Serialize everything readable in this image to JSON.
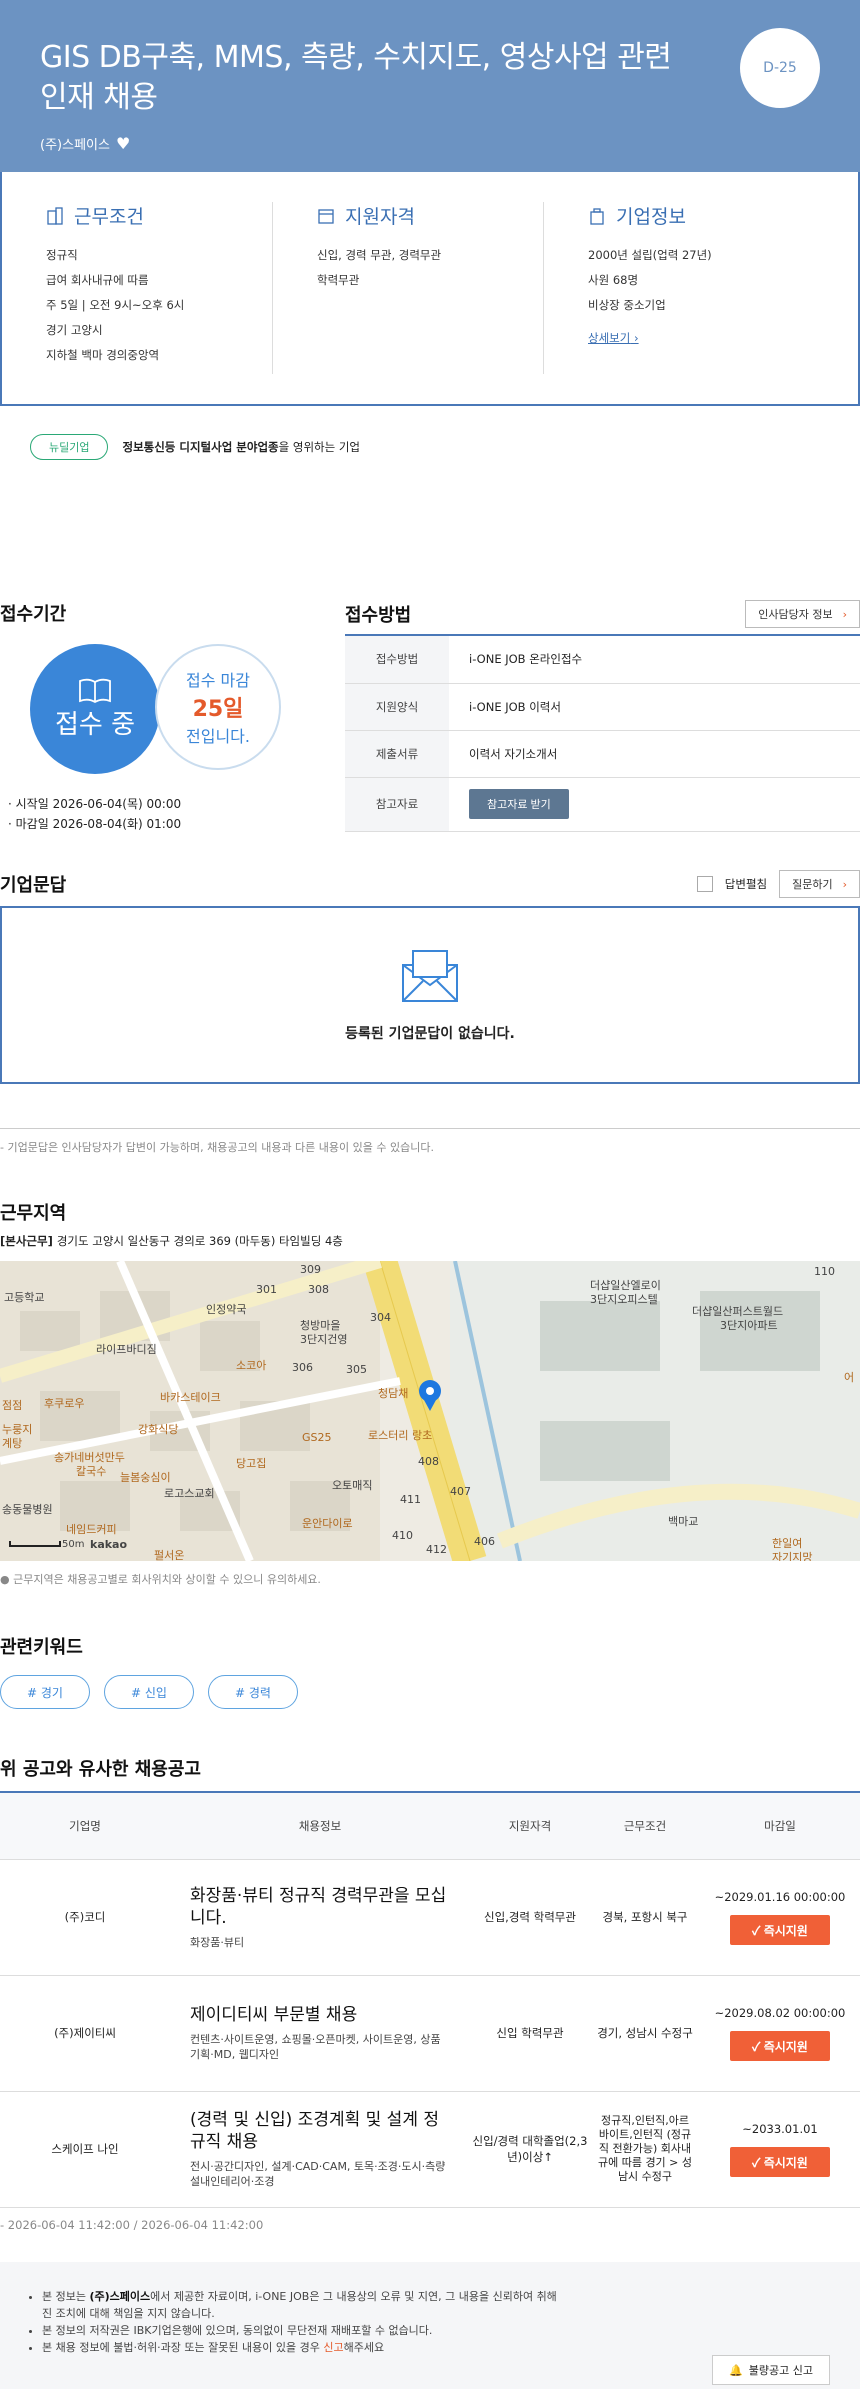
{
  "header": {
    "title": "GIS DB구축, MMS, 측량, 수치지도, 영상사업 관련 인재 채용",
    "company": "(주)스페이스",
    "dday": "D-25"
  },
  "info": {
    "conditions": {
      "title": "근무조건",
      "lines": [
        "정규직",
        "급여 회사내규에 따름",
        "주 5일 | 오전 9시~오후 6시",
        "경기 고양시",
        "지하철 백마 경의중앙역"
      ]
    },
    "qualifications": {
      "title": "지원자격",
      "lines": [
        "신입, 경력 무관, 경력무관",
        "학력무관"
      ]
    },
    "company": {
      "title": "기업정보",
      "lines": [
        "2000년 설립(업력 27년)",
        "사원 68명",
        "비상장 중소기업"
      ],
      "more": "상세보기"
    }
  },
  "new_company": {
    "badge": "뉴딜기업",
    "desc_bold": "정보통신등 디지털사업 분야업종",
    "desc_rest": "을 영위하는 기업"
  },
  "period": {
    "title": "접수기간",
    "status": "접수 중",
    "deadline_label": "접수 마감",
    "days": "25일",
    "days_suffix": "전입니다.",
    "start": "· 시작일 2026-06-04(목) 00:00",
    "end": "· 마감일 2026-08-04(화) 01:00"
  },
  "method": {
    "title": "접수방법",
    "hr_button": "인사담당자 정보",
    "rows": [
      {
        "label": "접수방법",
        "value": "i-ONE JOB 온라인접수"
      },
      {
        "label": "지원양식",
        "value": "i-ONE JOB 이력서"
      },
      {
        "label": "제출서류",
        "value": "이력서 자기소개서"
      },
      {
        "label": "참고자료",
        "value": ""
      }
    ],
    "ref_button": "참고자료 받기"
  },
  "qna": {
    "title": "기업문답",
    "checkbox_label": "답변펼침",
    "ask_button": "질문하기",
    "empty": "등록된 기업문답이 없습니다.",
    "note": "- 기업문답은 인사담당자가 답변이 가능하며, 채용공고의 내용과 다른 내용이 있을 수 있습니다."
  },
  "location": {
    "title": "근무지역",
    "addr_tag": "[본사근무]",
    "addr": "경기도 고양시 일산동구 경의로 369 (마두동) 타임빌딩 4층",
    "note": "● 근무지역은 채용공고별로 회사위치와 상이할 수 있으니 유의하세요.",
    "map_labels": {
      "l1": "인정약국",
      "l2": "라이프바디짐",
      "l3": "청방마을",
      "l4": "3단지건영",
      "l5": "소코아",
      "l6": "바카스테이크",
      "l7": "후쿠로우",
      "l8": "강화식당",
      "l9": "송가네버섯만두",
      "l10": "칼국수",
      "l11": "늘봄숭심이",
      "l12": "로고스교회",
      "l13": "네임드커피",
      "l14": "펄서온",
      "l15": "GS25",
      "l16": "당고집",
      "l17": "오토매직",
      "l18": "운안다이로",
      "l19": "로스터리 랑초",
      "l20": "청담채",
      "l21": "더샵일산엘로이",
      "l22": "3단지오피스텔",
      "l23": "더샵일산퍼스트월드",
      "l24": "3단지아파트",
      "l25": "백마교",
      "l26": "한일여",
      "l27": "자기지망",
      "l28": "고등학교",
      "l29": "점점",
      "l30": "누룽지",
      "l31": "계탕",
      "l32": "송동물병원",
      "l33": "어",
      "n301": "301",
      "n308": "308",
      "n309": "309",
      "n304": "304",
      "n306": "306",
      "n305": "305",
      "n408": "408",
      "n407": "407",
      "n411": "411",
      "n410": "410",
      "n412": "412",
      "n406": "406",
      "n110": "110",
      "scale": "50m",
      "kakao": "kakao"
    }
  },
  "keywords": {
    "title": "관련키워드",
    "items": [
      "# 경기",
      "# 신입",
      "# 경력"
    ]
  },
  "similar": {
    "title": "위 공고와 유사한 채용공고",
    "headers": [
      "기업명",
      "채용정보",
      "지원자격",
      "근무조건",
      "마감일"
    ],
    "rows": [
      {
        "company": "(주)코디",
        "title": "화장품·뷰티 정규직 경력무관을 모십니다.",
        "sub": "화장품·뷰티",
        "qual": "신입,경력 학력무관",
        "cond": "경북, 포항시 북구",
        "deadline": "~2029.01.16 00:00:00",
        "btn": "즉시지원"
      },
      {
        "company": "(주)제이티씨",
        "title": "제이디티씨 부문별 채용",
        "sub": "컨텐츠·사이트운영, 쇼핑몰·오픈마켓, 사이트운영, 상품기획·MD, 웹디자인",
        "qual": "신입 학력무관",
        "cond": "경기, 성남시 수정구",
        "deadline": "~2029.08.02 00:00:00",
        "btn": "즉시지원"
      },
      {
        "company": "스케이프 나인",
        "title": "(경력 및 신입) 조경계획 및 설계 정규직 채용",
        "sub": "전시·공간디자인, 설계·CAD·CAM, 토목·조경·도시·측량설내인테리어·조경",
        "qual": "신입/경력 대학졸업(2,3년)이상↑",
        "cond": "정규직,인턴직,아르바이트,인턴직 (정규직 전환가능) 회사내규에 따름 경기 > 성남시 수정구",
        "deadline": "~2033.01.01",
        "btn": "즉시지원"
      }
    ]
  },
  "updated": "- 2026-06-04 11:42:00 / 2026-06-04 11:42:00",
  "footer": {
    "l1a": "본 정보는 ",
    "l1b": "(주)스페이스",
    "l1c": "에서 제공한 자료이며, i-ONE JOB은 그 내용상의 오류 및 지연, 그 내용을 신뢰하여 취해진 조치에 대해 책임을 지지 않습니다.",
    "l2": "본 정보의 저작권은 IBK기업은행에 있으며, 동의없이 무단전재 재배포할 수 없습니다.",
    "l3a": "본 채용 정보에 불법·허위·과장 또는 잘못된 내용이 있을 경우 ",
    "l3b": "신고",
    "l3c": "해주세요",
    "report": "불량공고 신고"
  },
  "colors": {
    "header_bg": "#6c93c2",
    "accent_blue": "#4a78b8",
    "apply_orange": "#f06037",
    "new_green": "#2aa876"
  }
}
